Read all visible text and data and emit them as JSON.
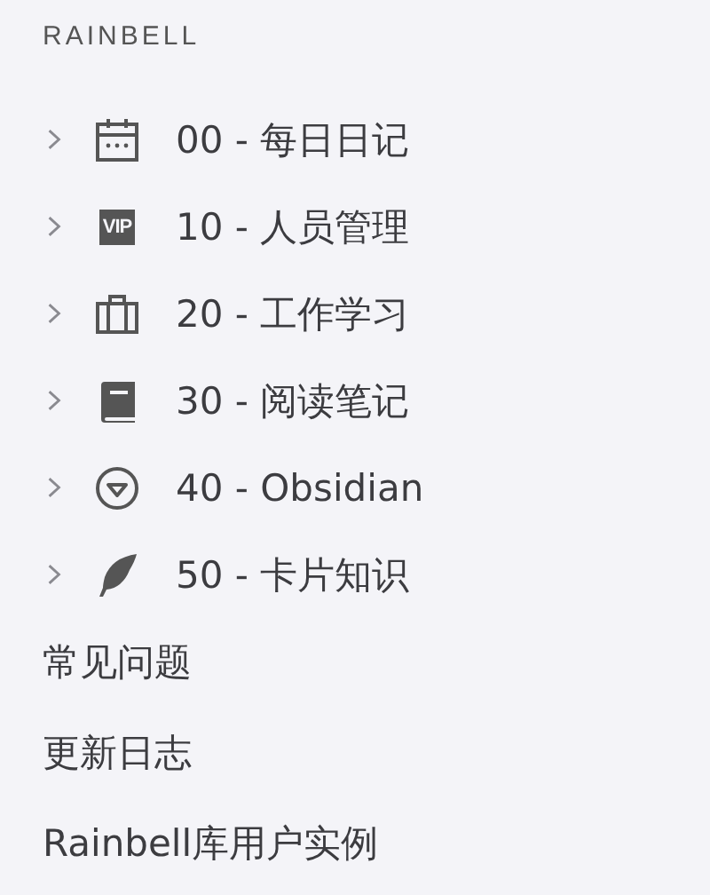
{
  "brand": "RAINBELL",
  "folders": [
    {
      "label": "00 - 每日日记",
      "expanded": false
    },
    {
      "label": "10 - 人员管理",
      "expanded": false,
      "badge": "VIP"
    },
    {
      "label": "20 - 工作学习",
      "expanded": false
    },
    {
      "label": "30 - 阅读笔记",
      "expanded": false
    },
    {
      "label": "40 - Obsidian",
      "expanded": false
    },
    {
      "label": "50 - 卡片知识",
      "expanded": false
    }
  ],
  "pages": [
    "常见问题",
    "更新日志",
    "Rainbell库用户实例"
  ]
}
